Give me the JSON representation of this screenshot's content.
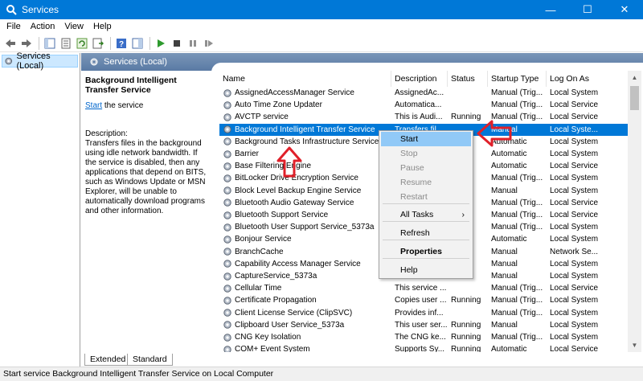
{
  "window": {
    "title": "Services",
    "minimize": "—",
    "maximize": "☐",
    "close": "✕"
  },
  "menubar": [
    "File",
    "Action",
    "View",
    "Help"
  ],
  "tree": {
    "item": "Services (Local)"
  },
  "main": {
    "header": "Services (Local)"
  },
  "description": {
    "service_name": "Background Intelligent Transfer Service",
    "start_link": "Start",
    "start_suffix": " the service",
    "body": "Description:\nTransfers files in the background using idle network bandwidth. If the service is disabled, then any applications that depend on BITS, such as Windows Update or MSN Explorer, will be unable to automatically download programs and other information."
  },
  "columns": [
    "Name",
    "Description",
    "Status",
    "Startup Type",
    "Log On As"
  ],
  "rows": [
    {
      "name": "AssignedAccessManager Service",
      "desc": "AssignedAc...",
      "status": "",
      "startup": "Manual (Trig...",
      "logon": "Local System"
    },
    {
      "name": "Auto Time Zone Updater",
      "desc": "Automatica...",
      "status": "",
      "startup": "Manual (Trig...",
      "logon": "Local Service"
    },
    {
      "name": "AVCTP service",
      "desc": "This is Audi...",
      "status": "Running",
      "startup": "Manual (Trig...",
      "logon": "Local Service"
    },
    {
      "name": "Background Intelligent Transfer Service",
      "desc": "Transfers fil...",
      "status": "",
      "startup": "Manual",
      "logon": "Local Syste...",
      "selected": true
    },
    {
      "name": "Background Tasks Infrastructure Service",
      "desc": "",
      "status": "ng",
      "startup": "Automatic",
      "logon": "Local System"
    },
    {
      "name": "Barrier",
      "desc": "",
      "status": "ng",
      "startup": "Automatic",
      "logon": "Local System"
    },
    {
      "name": "Base Filtering Engine",
      "desc": "",
      "status": "ng",
      "startup": "Automatic",
      "logon": "Local Service"
    },
    {
      "name": "BitLocker Drive Encryption Service",
      "desc": "",
      "status": "",
      "startup": "Manual (Trig...",
      "logon": "Local System"
    },
    {
      "name": "Block Level Backup Engine Service",
      "desc": "",
      "status": "",
      "startup": "Manual",
      "logon": "Local System"
    },
    {
      "name": "Bluetooth Audio Gateway Service",
      "desc": "",
      "status": "",
      "startup": "Manual (Trig...",
      "logon": "Local Service"
    },
    {
      "name": "Bluetooth Support Service",
      "desc": "",
      "status": "",
      "startup": "Manual (Trig...",
      "logon": "Local Service"
    },
    {
      "name": "Bluetooth User Support Service_5373a",
      "desc": "",
      "status": "",
      "startup": "Manual (Trig...",
      "logon": "Local System"
    },
    {
      "name": "Bonjour Service",
      "desc": "",
      "status": "ng",
      "startup": "Automatic",
      "logon": "Local System"
    },
    {
      "name": "BranchCache",
      "desc": "",
      "status": "",
      "startup": "Manual",
      "logon": "Network Se..."
    },
    {
      "name": "Capability Access Manager Service",
      "desc": "",
      "status": "ng",
      "startup": "Manual",
      "logon": "Local System"
    },
    {
      "name": "CaptureService_5373a",
      "desc": "",
      "status": "",
      "startup": "Manual",
      "logon": "Local System"
    },
    {
      "name": "Cellular Time",
      "desc": "This service ...",
      "status": "",
      "startup": "Manual (Trig...",
      "logon": "Local Service"
    },
    {
      "name": "Certificate Propagation",
      "desc": "Copies user ...",
      "status": "Running",
      "startup": "Manual (Trig...",
      "logon": "Local System"
    },
    {
      "name": "Client License Service (ClipSVC)",
      "desc": "Provides inf...",
      "status": "",
      "startup": "Manual (Trig...",
      "logon": "Local System"
    },
    {
      "name": "Clipboard User Service_5373a",
      "desc": "This user ser...",
      "status": "Running",
      "startup": "Manual",
      "logon": "Local System"
    },
    {
      "name": "CNG Key Isolation",
      "desc": "The CNG ke...",
      "status": "Running",
      "startup": "Manual (Trig...",
      "logon": "Local System"
    },
    {
      "name": "COM+ Event System",
      "desc": "Supports Sy...",
      "status": "Running",
      "startup": "Automatic",
      "logon": "Local Service"
    }
  ],
  "context_menu": [
    {
      "label": "Start",
      "state": "hover"
    },
    {
      "label": "Stop",
      "state": "disabled"
    },
    {
      "label": "Pause",
      "state": "disabled"
    },
    {
      "label": "Resume",
      "state": "disabled"
    },
    {
      "label": "Restart",
      "state": "disabled"
    },
    {
      "label": "All Tasks",
      "state": "submenu"
    },
    {
      "label": "Refresh",
      "state": "normal"
    },
    {
      "label": "Properties",
      "state": "bold"
    },
    {
      "label": "Help",
      "state": "normal"
    }
  ],
  "tabs": [
    "Extended",
    "Standard"
  ],
  "statusbar": "Start service Background Intelligent Transfer Service on Local Computer",
  "colors": {
    "accent": "#0078d7",
    "annotation": "#e0202a",
    "hover": "#91c9f7"
  }
}
